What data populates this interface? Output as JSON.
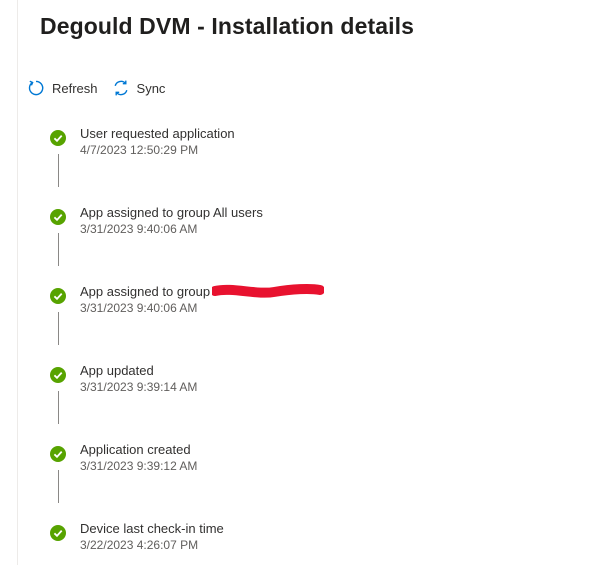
{
  "page": {
    "title": "Degould DVM - Installation details"
  },
  "toolbar": {
    "refresh": {
      "label": "Refresh",
      "icon": "refresh-icon"
    },
    "sync": {
      "label": "Sync",
      "icon": "sync-icon"
    }
  },
  "timeline": [
    {
      "title": "User requested application",
      "time": "4/7/2023 12:50:29 PM",
      "status": "success"
    },
    {
      "title": "App assigned to group All users",
      "time": "3/31/2023 9:40:06 AM",
      "status": "success"
    },
    {
      "title": "App assigned to group",
      "time": "3/31/2023 9:40:06 AM",
      "status": "success"
    },
    {
      "title": "App updated",
      "time": "3/31/2023 9:39:14 AM",
      "status": "success"
    },
    {
      "title": "Application created",
      "time": "3/31/2023 9:39:12 AM",
      "status": "success"
    },
    {
      "title": "Device last check-in time",
      "time": "3/22/2023 4:26:07 PM",
      "status": "success"
    }
  ],
  "colors": {
    "success": "#57a300",
    "accent": "#0078d4",
    "redaction": "#e8122f"
  }
}
